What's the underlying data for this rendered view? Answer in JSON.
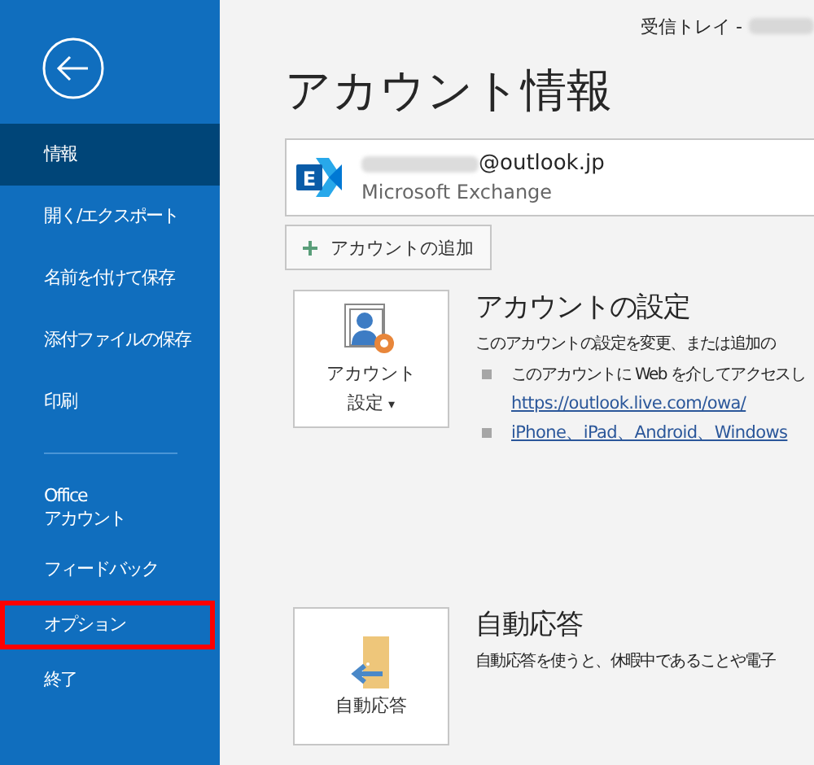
{
  "window": {
    "title": "受信トレイ -"
  },
  "sidebar": {
    "items": [
      {
        "label": "情報",
        "selected": true,
        "highlighted": false,
        "kind": "item"
      },
      {
        "label": "開く/エクスポート",
        "selected": false,
        "highlighted": false,
        "kind": "item"
      },
      {
        "label": "名前を付けて保存",
        "selected": false,
        "highlighted": false,
        "kind": "item"
      },
      {
        "label": "添付ファイルの保存",
        "selected": false,
        "highlighted": false,
        "kind": "item"
      },
      {
        "label": "印刷",
        "selected": false,
        "highlighted": false,
        "kind": "item"
      },
      {
        "kind": "divider"
      },
      {
        "label": "Office\nアカウント",
        "selected": false,
        "highlighted": false,
        "kind": "item"
      },
      {
        "label": "フィードバック",
        "selected": false,
        "highlighted": false,
        "kind": "item"
      },
      {
        "label": "オプション",
        "selected": false,
        "highlighted": true,
        "kind": "item"
      },
      {
        "label": "終了",
        "selected": false,
        "highlighted": false,
        "kind": "item"
      }
    ]
  },
  "page_title": "アカウント情報",
  "account": {
    "logo_letter": "E",
    "email": "@outlook.jp",
    "type": "Microsoft Exchange"
  },
  "add_account_button": "アカウントの追加",
  "sections": [
    {
      "kind": "settings",
      "button": [
        "アカウント",
        "設定"
      ],
      "caret": "▾",
      "title": "アカウントの設定",
      "description": "このアカウントの設定を変更、または追加の",
      "bullets": [
        {
          "text": "このアカウントに Web を介してアクセスし",
          "link": "https://outlook.live.com/owa/"
        },
        {
          "link": "iPhone、iPad、Android、Windows"
        }
      ]
    },
    {
      "kind": "autoreply",
      "button": [
        "自動応答"
      ],
      "title": "自動応答",
      "description": "自動応答を使うと、休暇中であることや電子"
    }
  ]
}
